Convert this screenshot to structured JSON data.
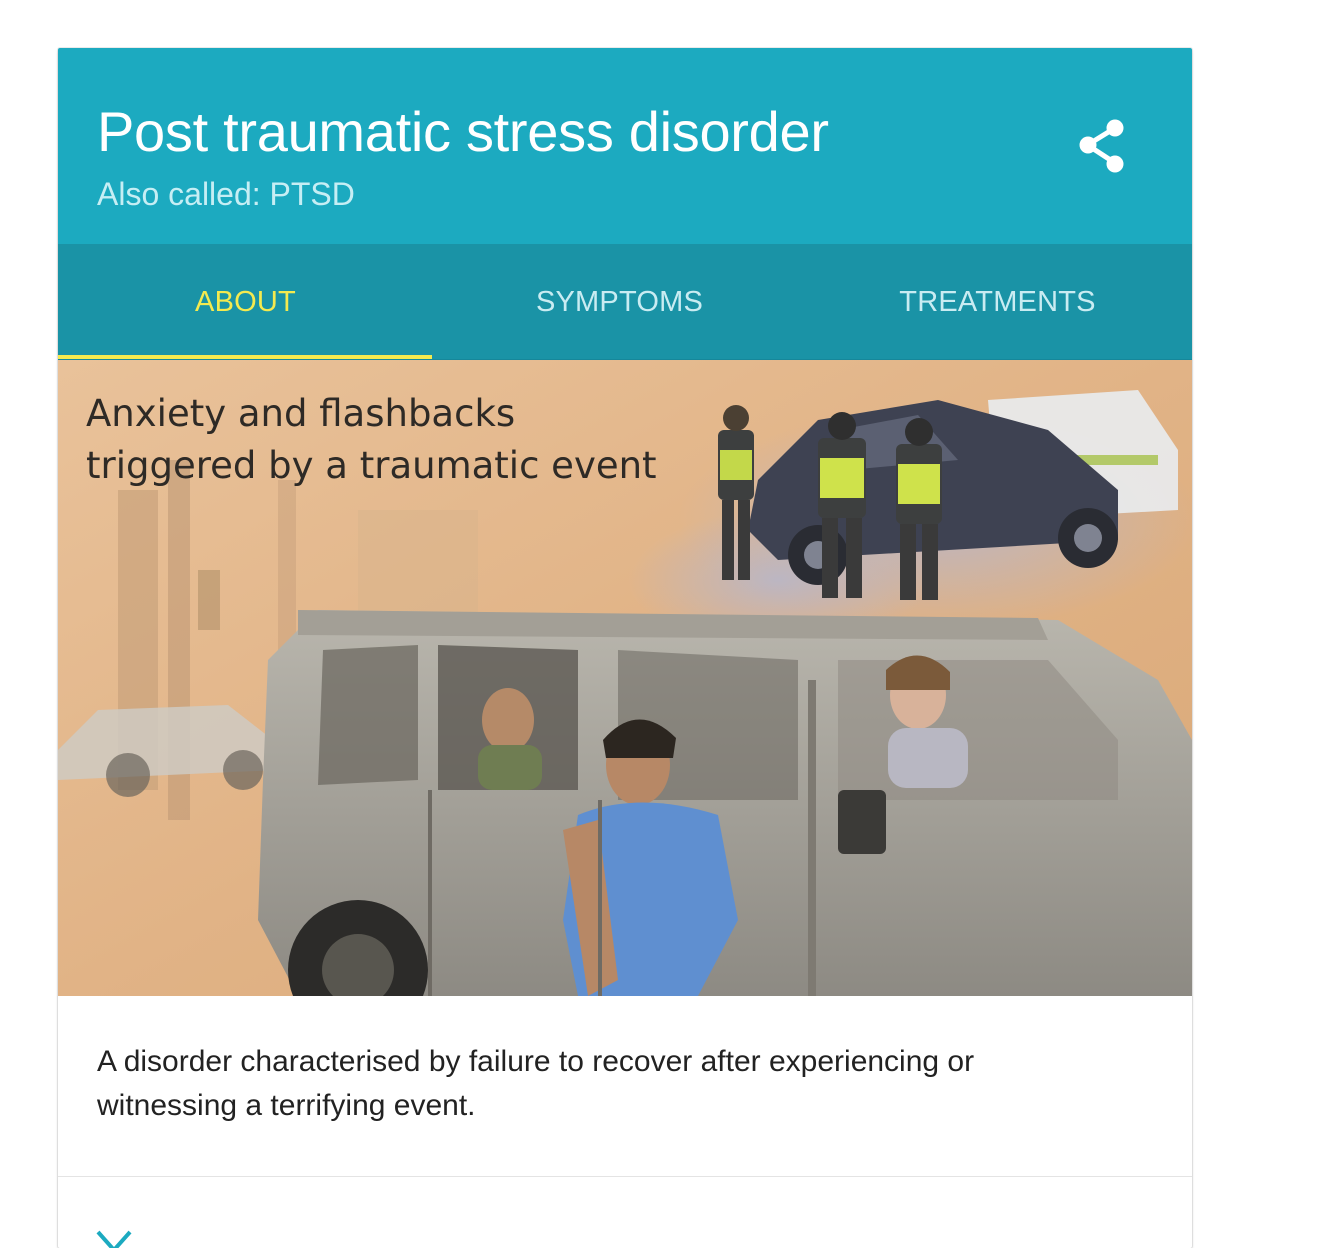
{
  "card": {
    "title": "Post traumatic stress disorder",
    "also_called": "Also called: PTSD",
    "share_icon": "share-icon",
    "colors": {
      "header": "#1caac0",
      "tabs": "#1a93a6",
      "active_tab": "#f4ea4f",
      "inactive_tab": "#c9ecf2"
    }
  },
  "tabs": [
    {
      "label": "ABOUT",
      "active": true
    },
    {
      "label": "SYMPTOMS",
      "active": false
    },
    {
      "label": "TREATMENTS",
      "active": false
    }
  ],
  "illustration": {
    "caption_line1": "Anxiety and flashbacks",
    "caption_line2": "triggered by a traumatic event"
  },
  "description": "A disorder characterised by failure to recover after experiencing or witnessing a terrifying event."
}
